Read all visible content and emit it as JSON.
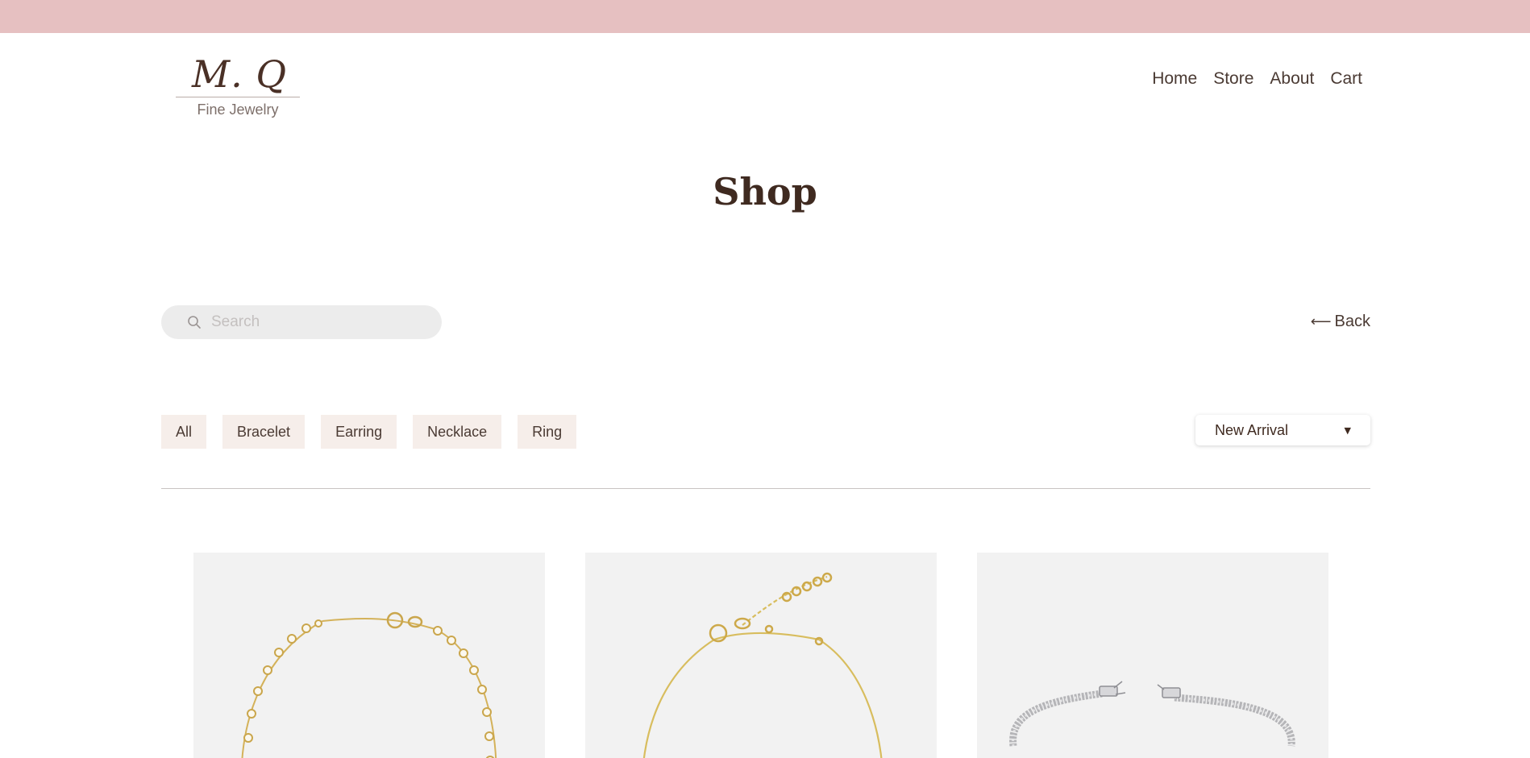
{
  "brand": {
    "logo_text": "M. Q",
    "tagline": "Fine Jewelry",
    "accent_color": "#e6c0c1",
    "text_color": "#4a3a33"
  },
  "nav": {
    "items": [
      {
        "label": "Home"
      },
      {
        "label": "Store"
      },
      {
        "label": "About"
      },
      {
        "label": "Cart"
      }
    ]
  },
  "page": {
    "title": "Shop"
  },
  "search": {
    "placeholder": "Search",
    "value": "",
    "icon": "search-icon"
  },
  "back": {
    "label": "Back",
    "icon": "arrow-left-icon"
  },
  "filters": {
    "categories": [
      {
        "label": "All"
      },
      {
        "label": "Bracelet"
      },
      {
        "label": "Earring"
      },
      {
        "label": "Necklace"
      },
      {
        "label": "Ring"
      }
    ],
    "chip_color": "#f6eeea"
  },
  "sort": {
    "selected": "New Arrival",
    "icon": "caret-down-icon"
  },
  "products": [
    {
      "image": "gold-bezel-diamond-bracelet"
    },
    {
      "image": "gold-chain-bracelet"
    },
    {
      "image": "silver-tennis-bracelet"
    }
  ]
}
